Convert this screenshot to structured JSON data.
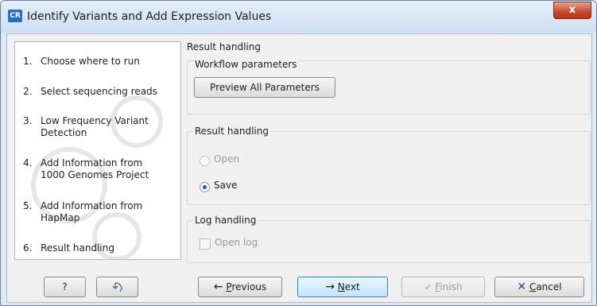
{
  "window": {
    "title": "Identify Variants and Add Expression Values",
    "app_icon_text": "CR",
    "close_symbol": "x"
  },
  "steps": [
    {
      "num": "1.",
      "label": "Choose where to run"
    },
    {
      "num": "2.",
      "label": "Select sequencing reads"
    },
    {
      "num": "3.",
      "label": "Low Frequency Variant Detection"
    },
    {
      "num": "4.",
      "label": "Add Information from 1000 Genomes Project"
    },
    {
      "num": "5.",
      "label": "Add Information from HapMap"
    },
    {
      "num": "6.",
      "label": "Result handling"
    }
  ],
  "panel": {
    "header": "Result handling",
    "workflow_parameters": {
      "title": "Workflow parameters",
      "preview_button": "Preview All Parameters"
    },
    "result_handling": {
      "title": "Result handling",
      "options": [
        {
          "label": "Open",
          "selected": false,
          "enabled": false
        },
        {
          "label": "Save",
          "selected": true,
          "enabled": true
        }
      ]
    },
    "log_handling": {
      "title": "Log handling",
      "open_log_label": "Open log",
      "open_log_checked": false
    }
  },
  "footer": {
    "help_label": "?",
    "previous_label": "Previous",
    "previous_underline": "P",
    "previous_rest": "revious",
    "next_underline": "N",
    "next_rest": "ext",
    "finish_underline": "F",
    "finish_rest": "inish",
    "cancel_underline": "C",
    "cancel_rest": "ancel"
  }
}
